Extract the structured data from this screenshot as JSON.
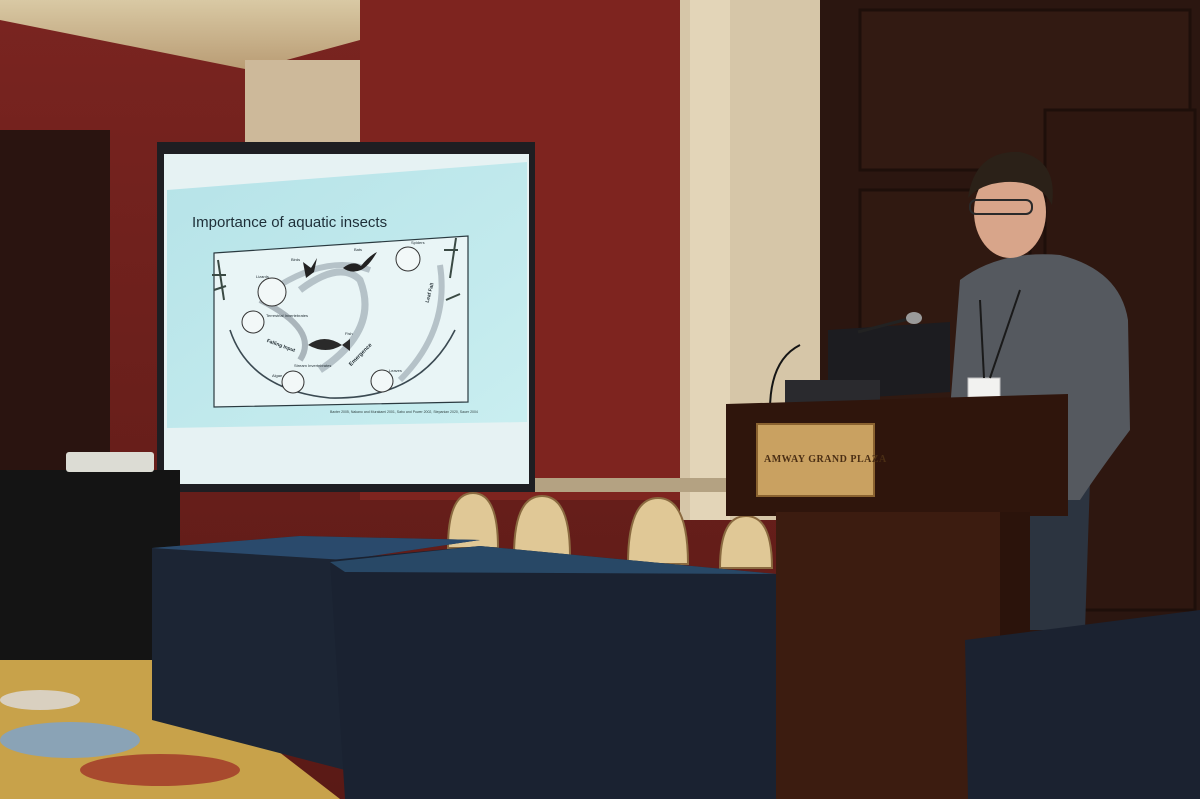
{
  "slide": {
    "title": "Importance of aquatic insects",
    "citation": "Baxter 2005, Nakano and Murakami 2001, Sabo and Power 2002, Stepanian 2020, Sauer 2004",
    "labels": {
      "birds": "Birds",
      "bats": "Bats",
      "spiders": "Spiders",
      "lizards": "Lizards",
      "terrestrial_invertebrates": "Terrestrial Invertebrates",
      "falling_input": "Falling Input",
      "fish": "Fish",
      "emergence": "Emergence",
      "leaf_fall": "Leaf Fall",
      "stream_invertebrates": "Stream Invertebrates",
      "algae": "Algae",
      "leaves": "Leaves"
    }
  },
  "podium": {
    "sign": "AMWAY GRAND PLAZA"
  },
  "colors": {
    "wall": "#8a2a22",
    "screen": "#bfe6ea",
    "table_cloth": "#1f2b3d",
    "podium_wood": "#3a1a10",
    "sign_gold": "#c9a161"
  }
}
